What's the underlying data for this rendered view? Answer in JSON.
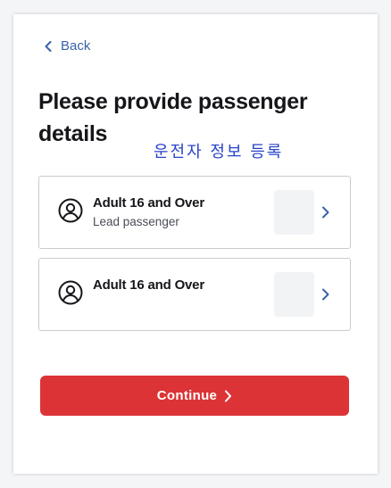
{
  "nav": {
    "back_label": "Back"
  },
  "page": {
    "title": "Please provide passenger details",
    "annotation": "운전자 정보 등록"
  },
  "passengers": [
    {
      "type": "Adult 16 and Over",
      "subtitle": "Lead passenger",
      "icon": "user-circle-icon"
    },
    {
      "type": "Adult 16 and Over",
      "subtitle": "",
      "icon": "user-circle-icon"
    }
  ],
  "actions": {
    "continue_label": "Continue"
  },
  "colors": {
    "accent_link": "#3a63a8",
    "primary_button": "#dc3436",
    "annotation_text": "#2843c8"
  }
}
